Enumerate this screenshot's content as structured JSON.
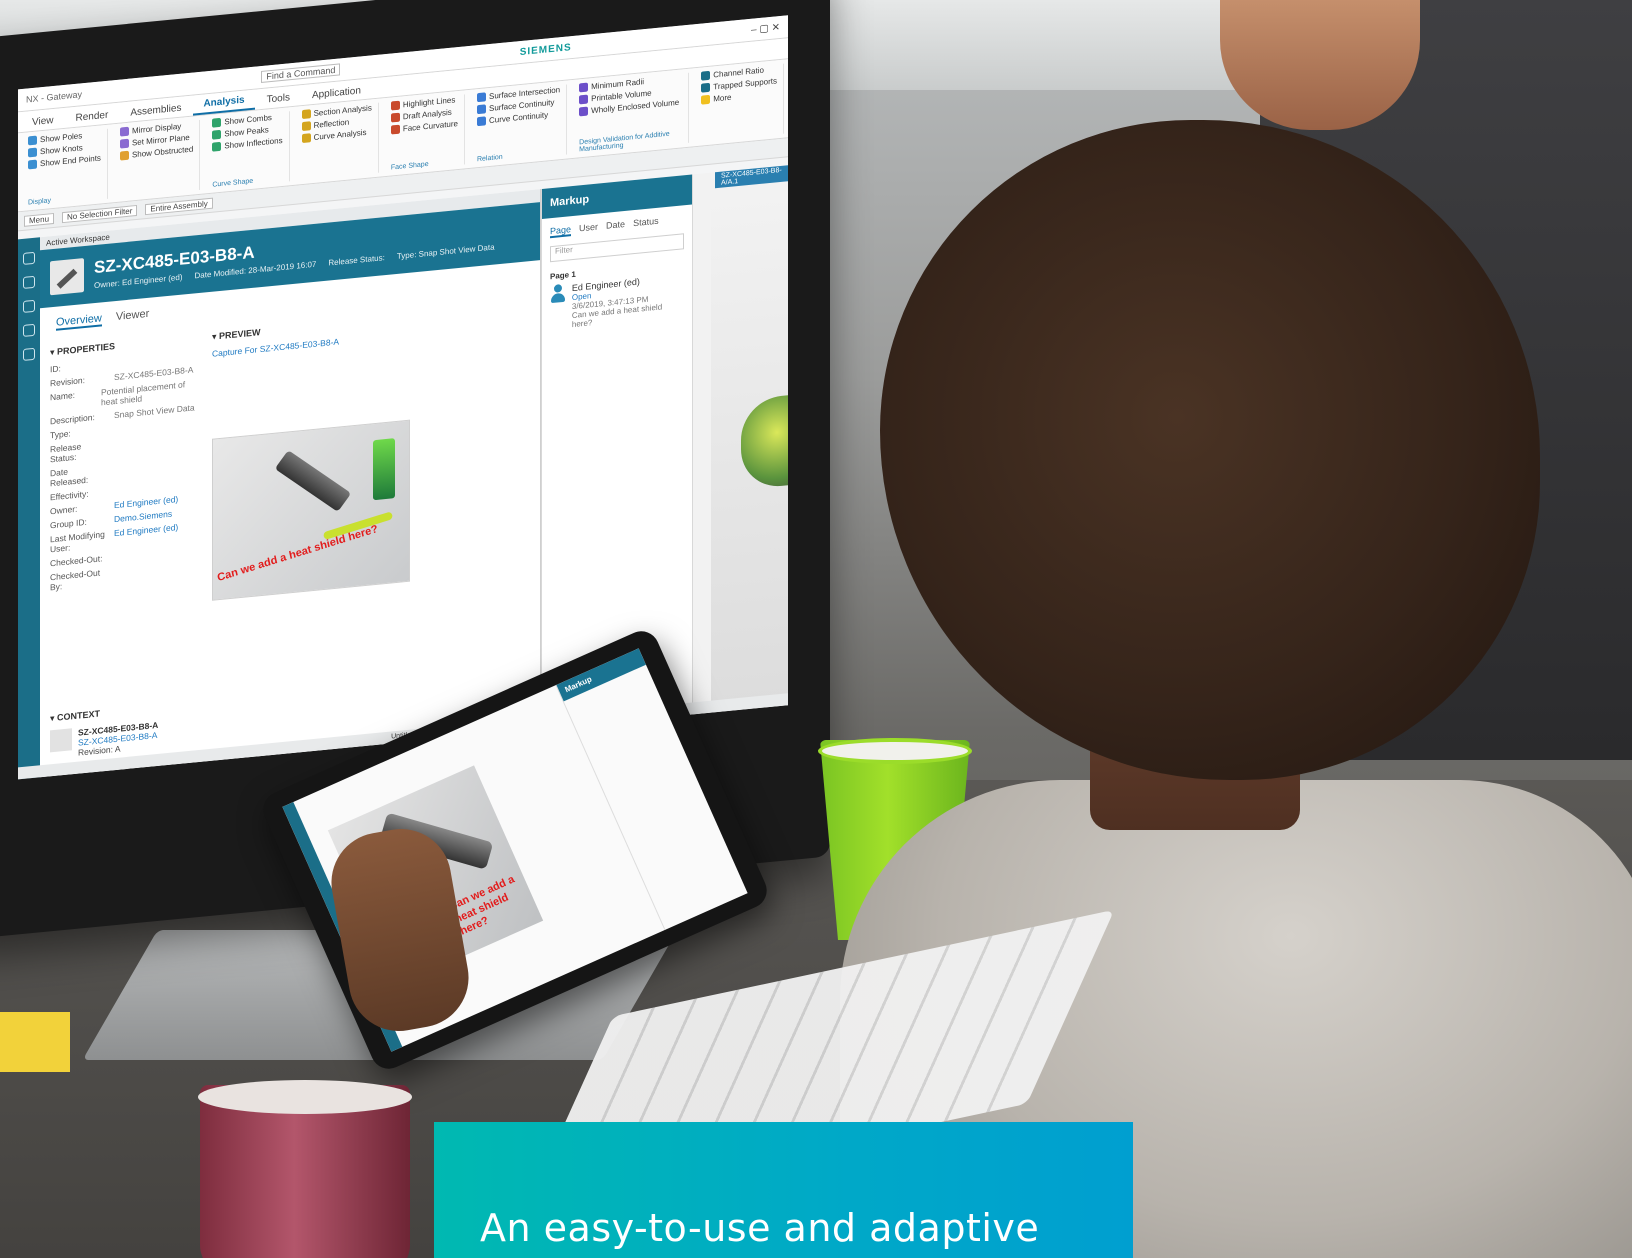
{
  "monitor_ui": {
    "brand": "SIEMENS",
    "window_title": "NX - Gateway",
    "search_placeholder": "Find a Command",
    "tabs": [
      "View",
      "Render",
      "Assemblies",
      "Analysis",
      "Tools",
      "Application"
    ],
    "ribbon": {
      "group1": [
        "Show Poles",
        "Show Knots",
        "Show End Points"
      ],
      "group2": [
        "Mirror Display",
        "Set Mirror Plane",
        "Show Obstructed"
      ],
      "group3": [
        "Show Combs",
        "Show Peaks",
        "Show Inflections"
      ],
      "group4": [
        "Section Analysis",
        "Reflection",
        "Curve Analysis"
      ],
      "group5": [
        "Highlight Lines",
        "Draft Analysis",
        "Face Curvature"
      ],
      "group6": [
        "Surface Intersection",
        "Surface Continuity",
        "Curve Continuity"
      ],
      "group7": [
        "Minimum Radii",
        "Printable Volume",
        "Wholly Enclosed Volume"
      ],
      "group8": [
        "Channel Ratio",
        "Trapped Supports",
        "More"
      ],
      "captions": [
        "Display",
        "Curve Shape",
        "Face Shape",
        "Relation",
        "Design Validation for Additive Manufacturing"
      ]
    },
    "filter_bar": {
      "menu": "Menu",
      "filter": "No Selection Filter",
      "assembly": "Entire Assembly"
    },
    "workspace_label": "Active Workspace",
    "object": {
      "id": "SZ-XC485-E03-B8-A",
      "owner": "Owner: Ed Engineer (ed)",
      "date_modified": "Date Modified: 28-Mar-2019 16:07",
      "release_status": "Release Status:",
      "type": "Type: Snap Shot View Data"
    },
    "view_tabs": [
      "Overview",
      "Viewer"
    ],
    "properties": {
      "title": "PROPERTIES",
      "rows": [
        {
          "key": "ID:",
          "value": ""
        },
        {
          "key": "Revision:",
          "value": "SZ-XC485-E03-B8-A"
        },
        {
          "key": "Name:",
          "value": "Potential placement of heat shield"
        },
        {
          "key": "Description:",
          "value": "Snap Shot View Data"
        },
        {
          "key": "Type:",
          "value": ""
        },
        {
          "key": "Release Status:",
          "value": ""
        },
        {
          "key": "Date Released:",
          "value": ""
        },
        {
          "key": "Effectivity:",
          "value": ""
        },
        {
          "key": "Owner:",
          "value": "Ed Engineer (ed)"
        },
        {
          "key": "Group ID:",
          "value": "Demo.Siemens"
        },
        {
          "key": "Last Modifying User:",
          "value": "Ed Engineer (ed)"
        },
        {
          "key": "Checked-Out:",
          "value": ""
        },
        {
          "key": "Checked-Out By:",
          "value": ""
        }
      ]
    },
    "preview": {
      "title": "PREVIEW",
      "caption_link": "Capture For SZ-XC485-E03-B8-A",
      "annotation": "Can we add a heat shield here?"
    },
    "context": {
      "title": "CONTEXT",
      "item_id": "SZ-XC485-E03-B8-A",
      "item_sub": "SZ-XC485-E03-B8-A",
      "item_rev": "Revision: A"
    },
    "markup": {
      "title": "Markup",
      "tabs": [
        "Page",
        "User",
        "Date",
        "Status"
      ],
      "filter_placeholder": "Filter",
      "page_label": "Page 1",
      "entry": {
        "user": "Ed Engineer (ed)",
        "status": "Open",
        "date": "3/6/2019, 3:47:13 PM",
        "text": "Can we add a heat shield here?"
      }
    },
    "viewport_tab": "SZ-XC485-E03-B8-A/A.1",
    "status_bar": "Untitled"
  },
  "tablet_ui": {
    "panel_title": "Markup",
    "annotation": "Can we add a heat shield here?"
  },
  "caption": {
    "text": "An easy-to-use and adaptive"
  },
  "colors": {
    "accent_teal": "#1a7391",
    "caption_gradient_start": "#00b9b1",
    "caption_gradient_end": "#009fd0",
    "annotation_red": "#e21c1c"
  }
}
